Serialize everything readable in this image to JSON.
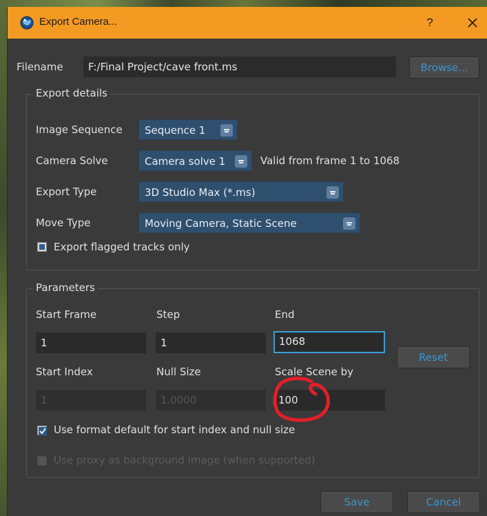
{
  "window": {
    "title": "Export Camera...",
    "help_label": "?"
  },
  "filename": {
    "label": "Filename",
    "value": "F:/Final Project/cave front.ms",
    "browse_label": "Browse..."
  },
  "export_details": {
    "title": "Export details",
    "image_sequence_label": "Image Sequence",
    "image_sequence_value": "Sequence 1",
    "camera_solve_label": "Camera Solve",
    "camera_solve_value": "Camera solve 1",
    "valid_range_text": "Valid from frame 1 to 1068",
    "export_type_label": "Export Type",
    "export_type_value": "3D Studio Max (*.ms)",
    "move_type_label": "Move Type",
    "move_type_value": "Moving Camera, Static Scene",
    "flagged_label": "Export flagged tracks only"
  },
  "parameters": {
    "title": "Parameters",
    "start_frame_label": "Start Frame",
    "start_frame_value": "1",
    "step_label": "Step",
    "step_value": "1",
    "end_label": "End",
    "end_value": "1068",
    "reset_label": "Reset",
    "start_index_label": "Start Index",
    "start_index_value": "1",
    "null_size_label": "Null Size",
    "null_size_value": "1.0000",
    "scale_label": "Scale Scene by",
    "scale_value": "100",
    "use_format_default_label": "Use format default for start index and null size",
    "use_format_default_checked": true,
    "use_proxy_label": "Use proxy as background image (when supported)",
    "use_proxy_checked": false
  },
  "footer": {
    "save_label": "Save",
    "cancel_label": "Cancel"
  },
  "colors": {
    "titlebar": "#f39a22",
    "dialog_bg": "#3a3a3a",
    "field_bg": "#2a2a2a",
    "select_bg": "#2f4f6e",
    "button_text": "#3b96cf",
    "focus_border": "#3ba0d8",
    "annotation_red": "#e0202a"
  },
  "icons": {
    "app": "app-globe-icon",
    "close": "close-icon",
    "dropdown": "dropdown-arrow-icon",
    "annotation": "hand-drawn-circle"
  }
}
